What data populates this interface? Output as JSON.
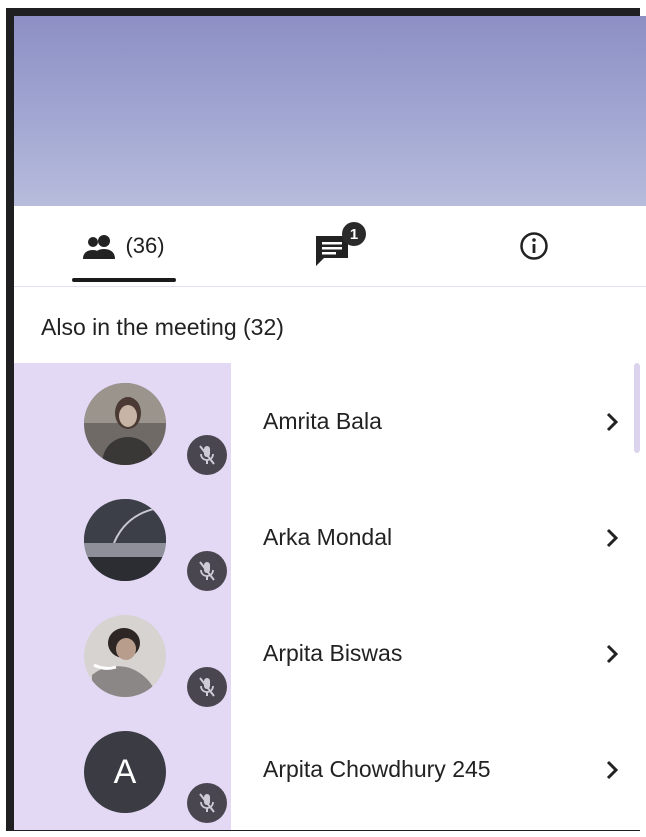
{
  "tabs": {
    "people_label": "(36)",
    "chat_badge": "1"
  },
  "section": {
    "title": "Also in the meeting (32)"
  },
  "participants": [
    {
      "name": "Amrita Bala",
      "avatar": "photo",
      "muted": true
    },
    {
      "name": "Arka Mondal",
      "avatar": "photo",
      "muted": true
    },
    {
      "name": "Arpita Biswas",
      "avatar": "photo",
      "muted": true
    },
    {
      "name": "Arpita Chowdhury 245",
      "avatar": "letter",
      "avatar_letter": "A",
      "muted": true
    }
  ],
  "colors": {
    "video_strip": "#9ea3d0",
    "avatar_column": "#e3d9f5",
    "mic_badge": "#4a4650",
    "tab_underline": "#1a1a1a"
  }
}
